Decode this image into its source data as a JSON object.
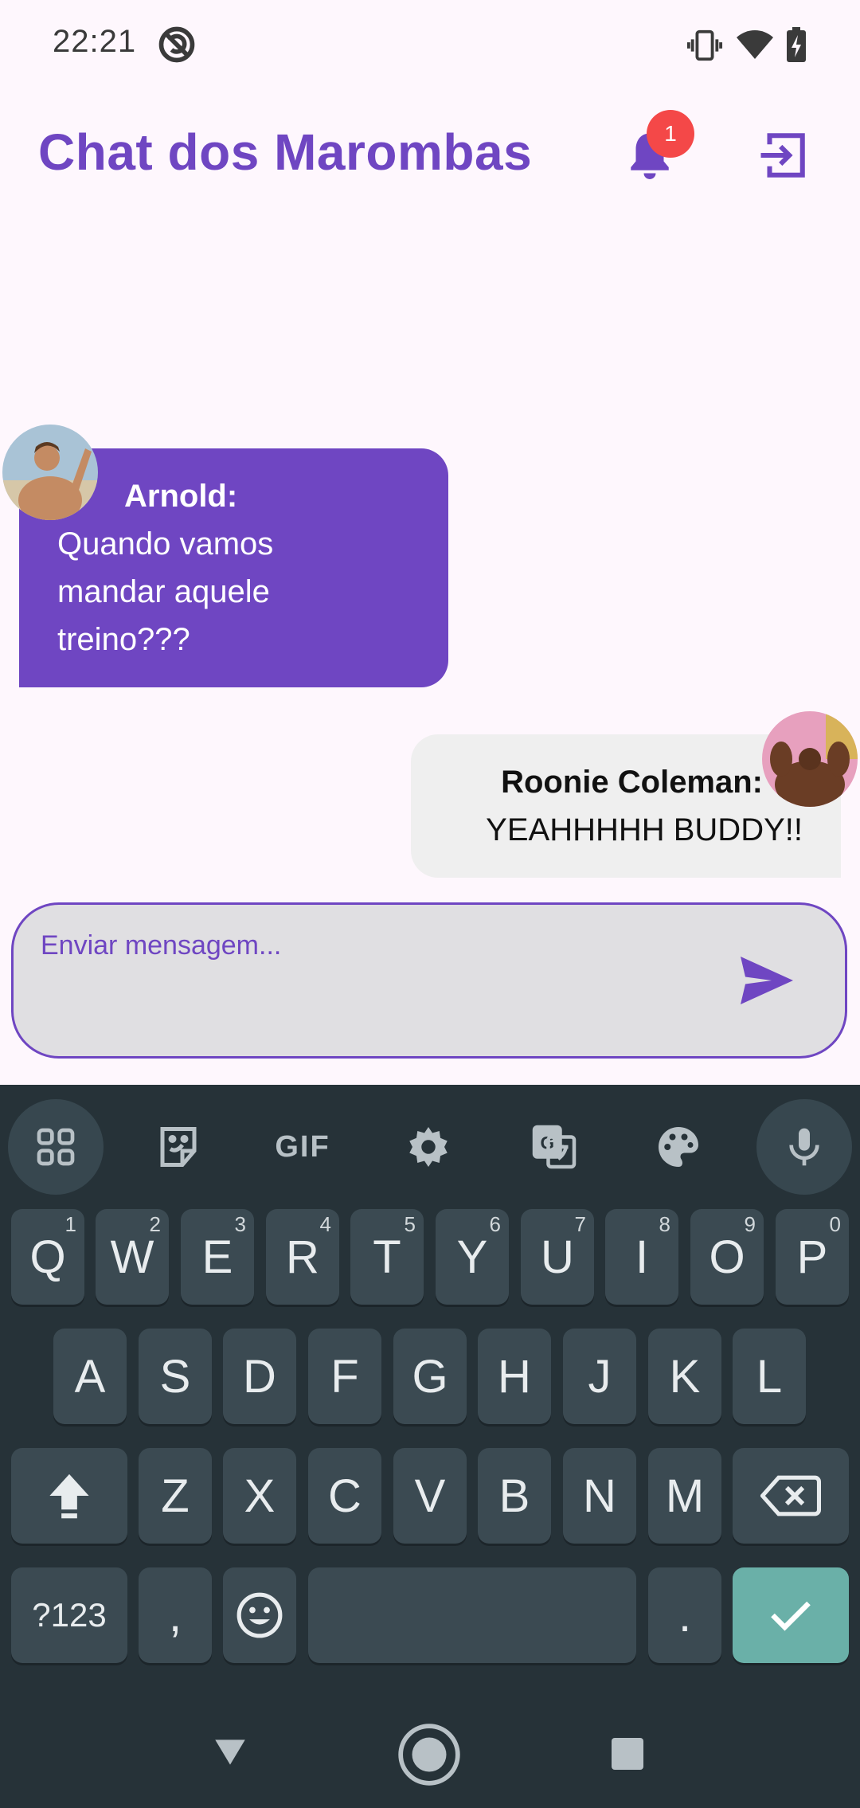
{
  "status_bar": {
    "time": "22:21"
  },
  "app_bar": {
    "title": "Chat dos Marombas",
    "notification_count": "1"
  },
  "messages": [
    {
      "sender": "Arnold:",
      "text": "Quando vamos mandar aquele treino???",
      "lines": [
        "Quando vamos",
        "mandar aquele",
        "treino???"
      ]
    },
    {
      "sender": "Roonie Coleman:",
      "text": "YEAHHHHH BUDDY!!"
    }
  ],
  "input": {
    "placeholder": "Enviar mensagem...",
    "value": ""
  },
  "keyboard": {
    "toolbar": [
      "apps-icon",
      "sticker-icon",
      "GIF",
      "settings-icon",
      "translate-icon",
      "palette-icon",
      "mic-icon"
    ],
    "gif_label": "GIF",
    "row1": [
      "Q",
      "W",
      "E",
      "R",
      "T",
      "Y",
      "U",
      "I",
      "O",
      "P"
    ],
    "row1_hints": [
      "1",
      "2",
      "3",
      "4",
      "5",
      "6",
      "7",
      "8",
      "9",
      "0"
    ],
    "row2": [
      "A",
      "S",
      "D",
      "F",
      "G",
      "H",
      "J",
      "K",
      "L"
    ],
    "row3": [
      "Z",
      "X",
      "C",
      "V",
      "B",
      "N",
      "M"
    ],
    "symbols_label": "?123",
    "comma": ",",
    "period": "."
  },
  "colors": {
    "accent": "#6F46C2",
    "badge": "#F44848",
    "keyboard_bg": "#263238",
    "key_bg": "#3B4A52",
    "enter_key": "#6AB0A8",
    "bubble_other": "#EFEFEF"
  }
}
